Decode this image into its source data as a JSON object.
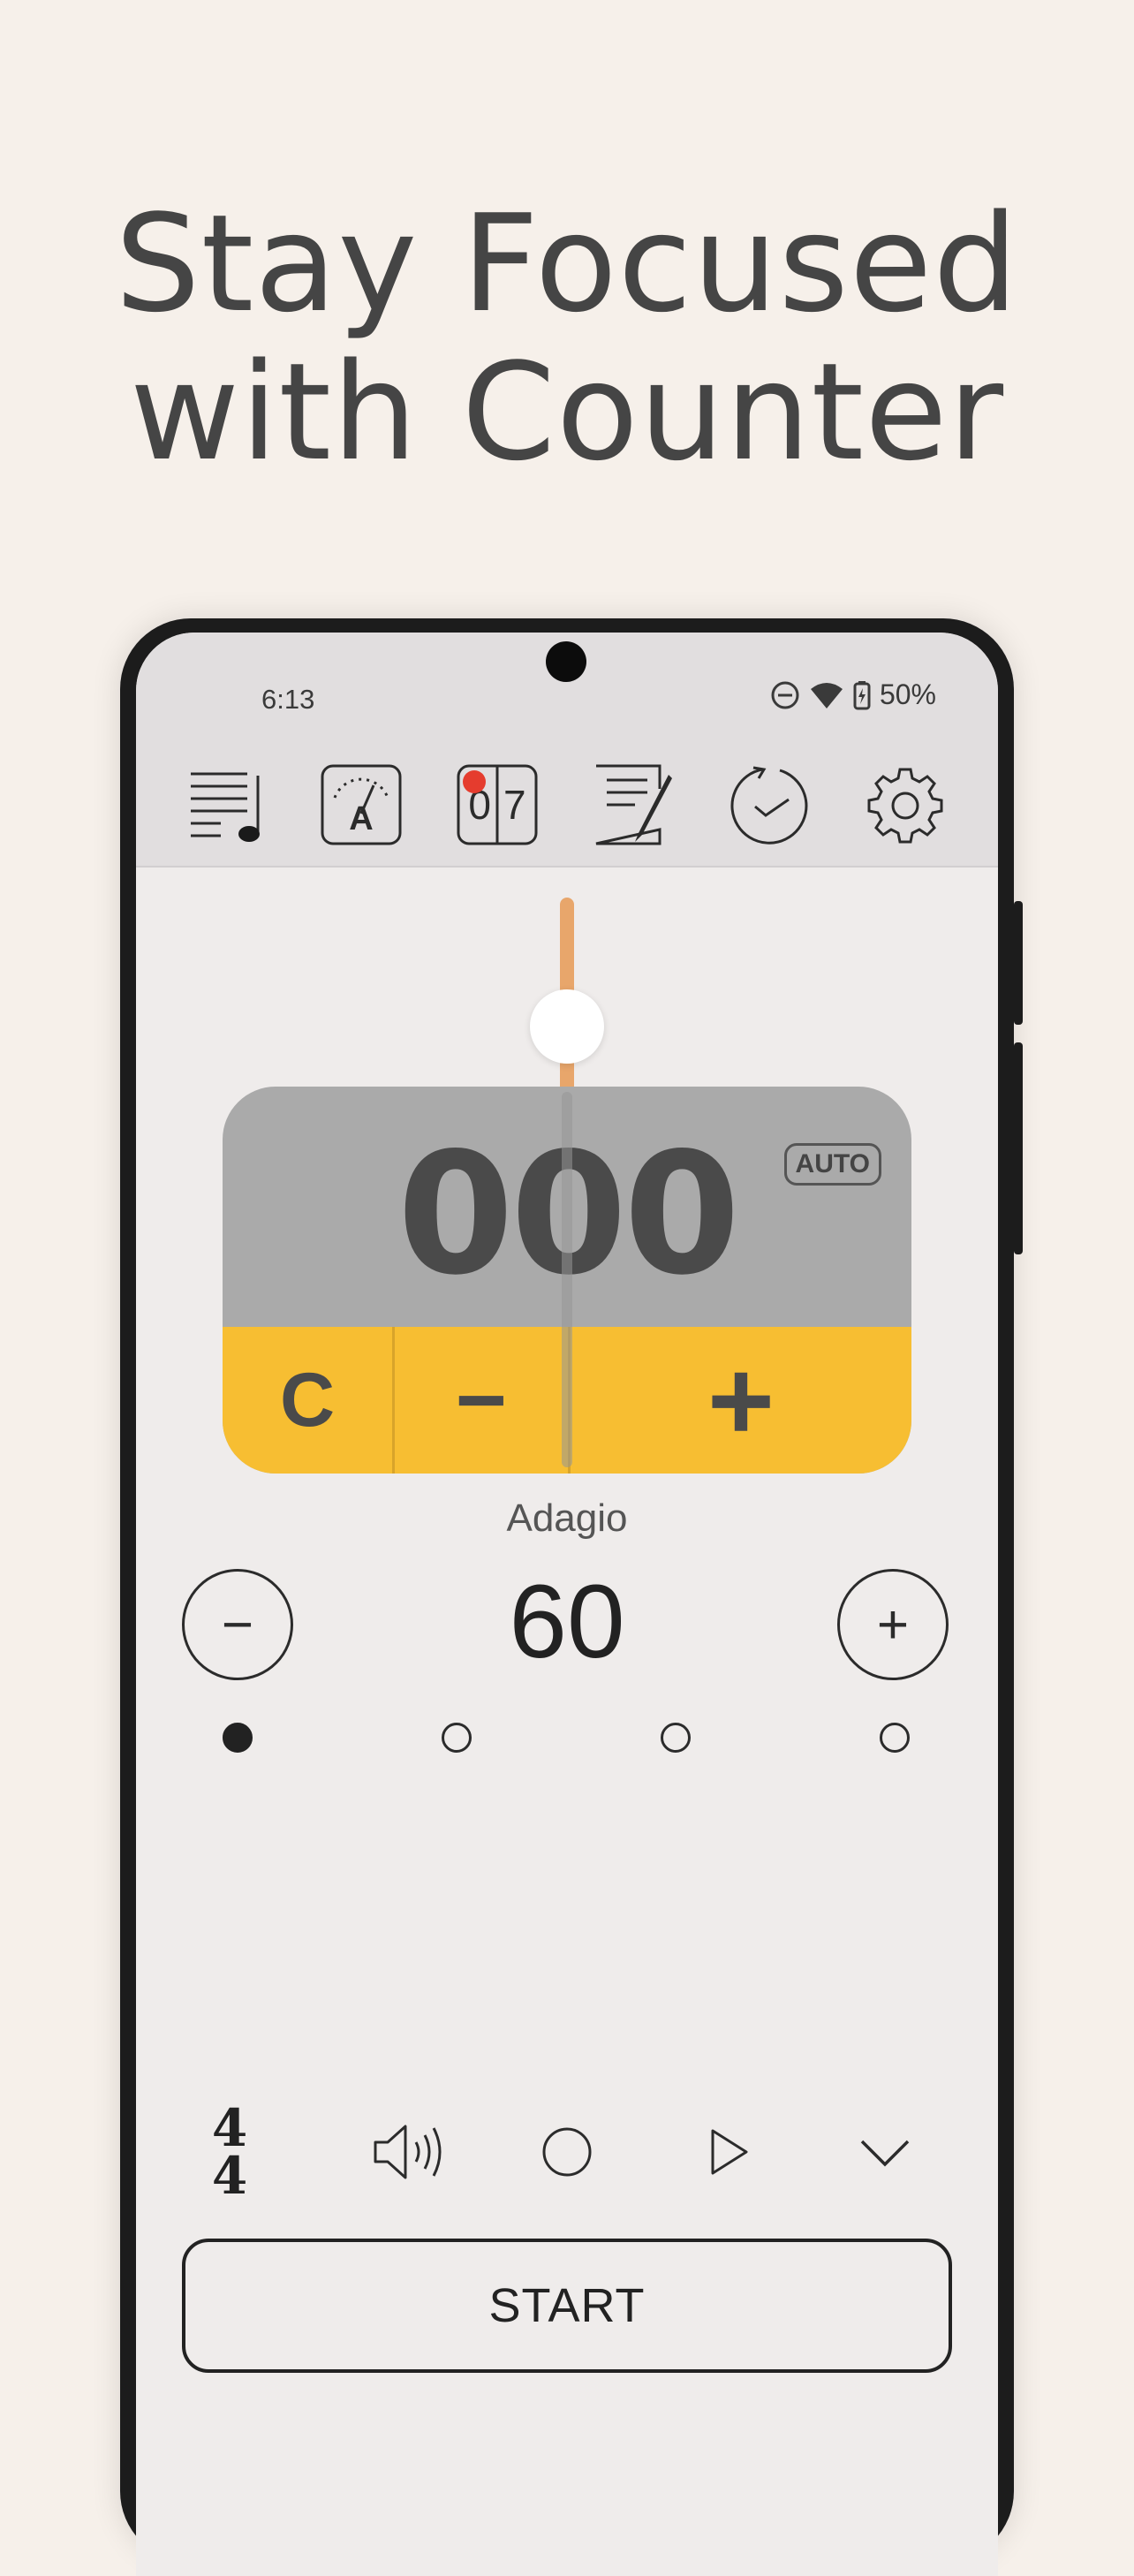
{
  "headline": {
    "line1": "Stay Focused",
    "line2": "with Counter"
  },
  "status_bar": {
    "time": "6:13",
    "battery": "50%"
  },
  "toolbar": {
    "items": [
      {
        "name": "setlist-icon"
      },
      {
        "name": "tuner-icon",
        "label": "A"
      },
      {
        "name": "counter-icon",
        "label": "07"
      },
      {
        "name": "notes-icon"
      },
      {
        "name": "timer-icon"
      },
      {
        "name": "settings-icon"
      }
    ]
  },
  "counter": {
    "value": "000",
    "auto_label": "AUTO",
    "clear_label": "C",
    "minus_label": "−",
    "plus_label": "+"
  },
  "tempo": {
    "name": "Adagio",
    "bpm": "60",
    "decrease_label": "−",
    "increase_label": "+"
  },
  "beats": {
    "count": 4,
    "active_index": 0
  },
  "controls": {
    "time_signature_top": "4",
    "time_signature_bottom": "4"
  },
  "start_label": "START",
  "colors": {
    "background": "#f6f0ea",
    "counter_display": "#aaaaaa",
    "counter_buttons": "#f7be32",
    "slider": "#e8a66b",
    "notification_dot": "#e53c2e"
  }
}
